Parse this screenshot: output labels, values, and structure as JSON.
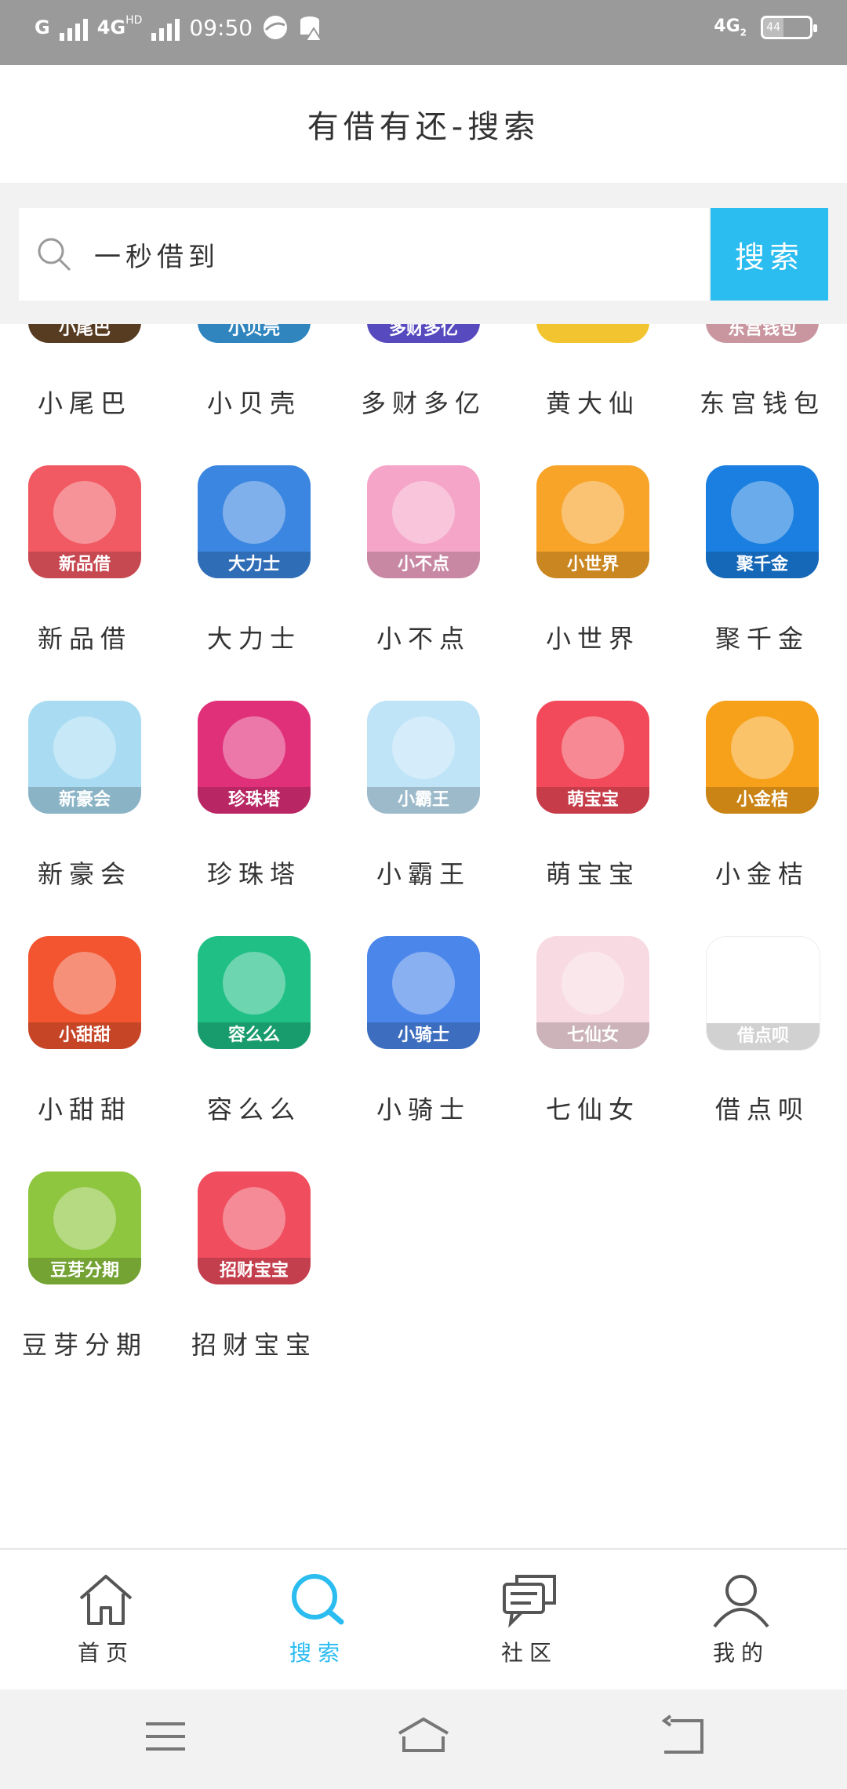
{
  "status": {
    "network1": "G",
    "network2": "4G",
    "network2_sup": "HD",
    "time": "09:50",
    "network3": "4G",
    "network3_sub": "2",
    "battery": "44",
    "battery_level_percent": 44
  },
  "header": {
    "title": "有借有还-搜索"
  },
  "search": {
    "value": "一秒借到",
    "button": "搜索"
  },
  "apps": [
    {
      "name": "小尾巴",
      "tag": "小尾巴",
      "color": "#6b4a2a"
    },
    {
      "name": "小贝壳",
      "tag": "小贝壳",
      "color": "#3ba3e8"
    },
    {
      "name": "多财多亿",
      "tag": "多财多亿",
      "color": "#6a5be8"
    },
    {
      "name": "黄大仙",
      "tag": "",
      "color": "#f2c530"
    },
    {
      "name": "东宫钱包",
      "tag": "东宫钱包",
      "color": "#f6b8c4"
    },
    {
      "name": "新品借",
      "tag": "新品借",
      "color": "#f25a63"
    },
    {
      "name": "大力士",
      "tag": "大力士",
      "color": "#3b86e0"
    },
    {
      "name": "小不点",
      "tag": "小不点",
      "color": "#f5a6c8"
    },
    {
      "name": "小世界",
      "tag": "小世界",
      "color": "#f7a428"
    },
    {
      "name": "聚千金",
      "tag": "聚千金",
      "color": "#1a7fe0"
    },
    {
      "name": "新豪会",
      "tag": "新豪会",
      "color": "#a9dcf2"
    },
    {
      "name": "珍珠塔",
      "tag": "珍珠塔",
      "color": "#e1307a"
    },
    {
      "name": "小霸王",
      "tag": "小霸王",
      "color": "#bfe3f7"
    },
    {
      "name": "萌宝宝",
      "tag": "萌宝宝",
      "color": "#f24a5a"
    },
    {
      "name": "小金桔",
      "tag": "小金桔",
      "color": "#f7a11a"
    },
    {
      "name": "小甜甜",
      "tag": "小甜甜",
      "color": "#f25530"
    },
    {
      "name": "容么么",
      "tag": "容么么",
      "color": "#1fbf86"
    },
    {
      "name": "小骑士",
      "tag": "小骑士",
      "color": "#4b86ea"
    },
    {
      "name": "七仙女",
      "tag": "七仙女",
      "color": "#f8dbe2"
    },
    {
      "name": "借点呗",
      "tag": "借点呗",
      "color": "#ffffff"
    },
    {
      "name": "豆芽分期",
      "tag": "豆芽分期",
      "color": "#8ec63f"
    },
    {
      "name": "招财宝宝",
      "tag": "招财宝宝",
      "color": "#f04d5e"
    }
  ],
  "tabs": [
    {
      "label": "首页",
      "icon": "home-icon"
    },
    {
      "label": "搜索",
      "icon": "search-icon"
    },
    {
      "label": "社区",
      "icon": "chat-icon"
    },
    {
      "label": "我的",
      "icon": "user-icon"
    }
  ],
  "colors": {
    "accent": "#2bbcf0",
    "statusbar": "#9a9a9a"
  }
}
